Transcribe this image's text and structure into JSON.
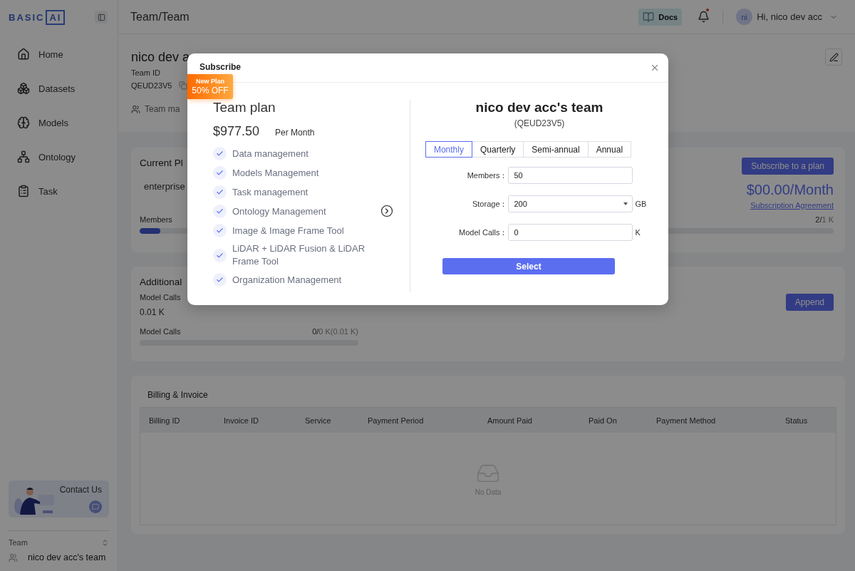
{
  "sidebar": {
    "logo": {
      "left": "BASIC",
      "right": "AI"
    },
    "items": [
      {
        "label": "Home",
        "kind": "home"
      },
      {
        "label": "Datasets",
        "kind": "datasets"
      },
      {
        "label": "Models",
        "kind": "models"
      },
      {
        "label": "Ontology",
        "kind": "ontology"
      },
      {
        "label": "Task",
        "kind": "task"
      }
    ],
    "contact": "Contact Us",
    "team_label": "Team",
    "team_name": "nico dev acc's team"
  },
  "header": {
    "breadcrumb": "Team/Team",
    "docs": "Docs",
    "avatar": "ni",
    "greeting": "Hi, nico dev acc"
  },
  "team": {
    "title": "nico dev a",
    "id_label": "Team ID",
    "id": "QEUD23V5",
    "tab": "Team ma"
  },
  "current_plan": {
    "title": "Current Pl",
    "plan": "enterprise",
    "button": "Subscribe to a plan",
    "price": "$00.00/Month",
    "agreement": "Subscription Agreement",
    "meter": {
      "label": "Members",
      "used": "2/",
      "total": "1 K",
      "level": 0.03
    }
  },
  "additional": {
    "title": "Additional",
    "label": "Model Calls",
    "value": "0.01 K",
    "button": "Append",
    "meter": {
      "label": "Model Calls",
      "used": "0/",
      "total": "0 K(0.01 K)",
      "level": 0
    }
  },
  "billing": {
    "title": "Billing & Invoice",
    "columns": [
      "Billing ID",
      "Invoice ID",
      "Service",
      "Payment Period",
      "Amount Paid",
      "Paid On",
      "Payment Method",
      "Status"
    ],
    "empty": "No Data"
  },
  "modal": {
    "title": "Subscribe",
    "badge": {
      "top": "New Plan",
      "bottom": "50% OFF"
    },
    "plan": {
      "name": "Team plan",
      "price": "$977.50",
      "period": "Per Month",
      "features": [
        "Data management",
        "Models Management",
        "Task management",
        "Ontology Management",
        "Image & Image Frame Tool",
        "LiDAR + LiDAR Fusion & LiDAR Frame Tool",
        "Organization Management"
      ]
    },
    "team": "nico dev acc's team",
    "team_id": "(QEUD23V5)",
    "periods": [
      {
        "label": "Monthly",
        "selected": true
      },
      {
        "label": "Quarterly",
        "selected": false
      },
      {
        "label": "Semi-annual",
        "selected": false
      },
      {
        "label": "Annual",
        "selected": false
      }
    ],
    "fields": [
      {
        "label": "Members：",
        "value": "50",
        "kind": "input"
      },
      {
        "label": "Storage：",
        "value": "200",
        "kind": "select",
        "unit": "GB"
      },
      {
        "label": "Model Calls：",
        "value": "0",
        "kind": "input",
        "unit": "K"
      }
    ],
    "button": "Select"
  }
}
